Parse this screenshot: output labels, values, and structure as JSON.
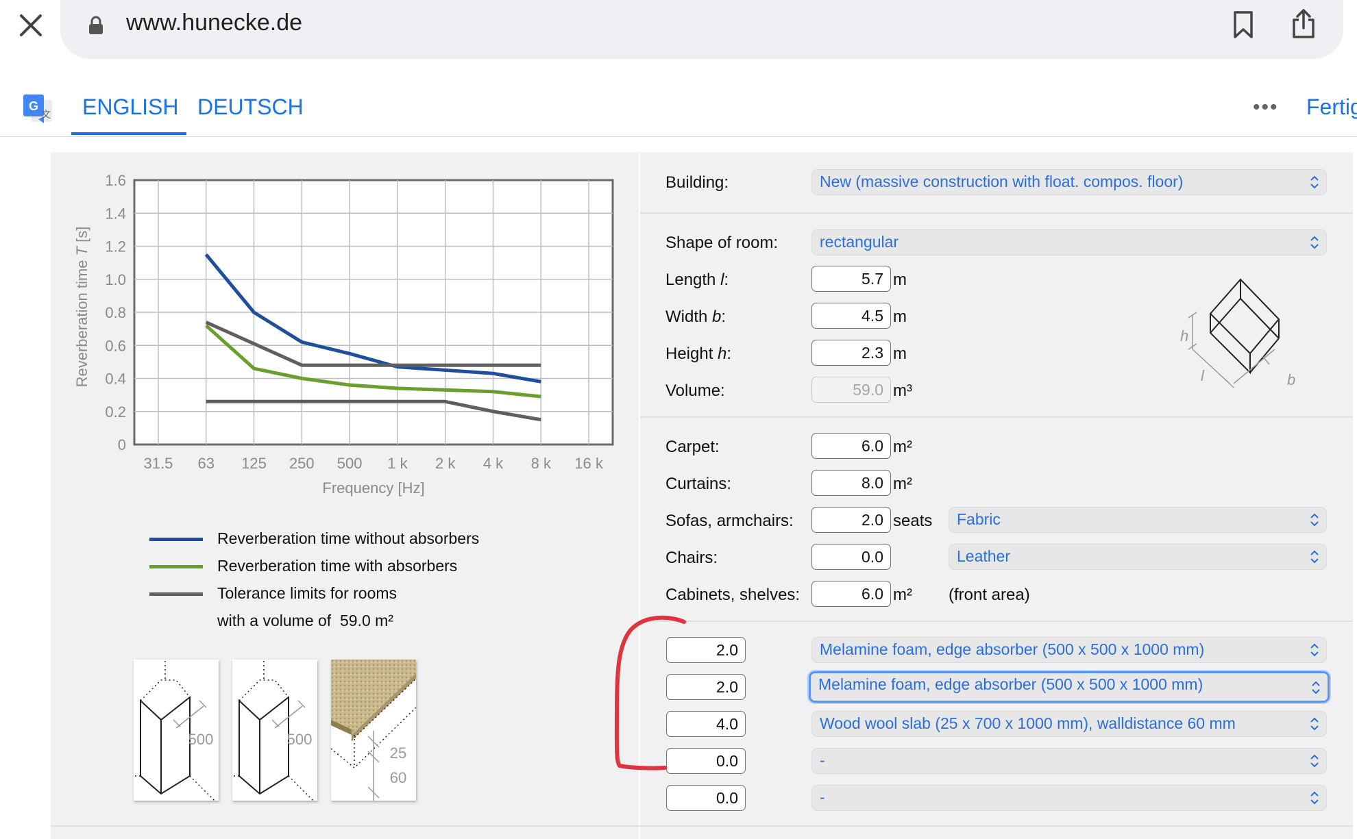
{
  "browser": {
    "url": "www.hunecke.de",
    "icons": [
      "close-icon",
      "lock-icon",
      "bookmark-icon",
      "share-icon"
    ]
  },
  "translate_bar": {
    "tab_english": "ENGLISH",
    "tab_deutsch": "DEUTSCH",
    "more": "•••",
    "done": "Fertig",
    "accent": "#1a73e8"
  },
  "room": {
    "building_label": "Building:",
    "building_value": "New (massive construction with float. compos. floor)",
    "shape_label": "Shape of room:",
    "shape_value": "rectangular",
    "length_label": "Length ",
    "length_var": "l",
    "length_value": "5.7",
    "width_label": "Width ",
    "width_var": "b",
    "width_value": "4.5",
    "height_label": "Height ",
    "height_var": "h",
    "height_value": "2.3",
    "volume_label": "Volume:",
    "volume_value": "59.0",
    "unit_m": "m",
    "unit_m3": "m³",
    "diagram_h": "h",
    "diagram_l": "l",
    "diagram_b": "b"
  },
  "furniture": {
    "carpet_label": "Carpet:",
    "carpet_value": "6.0",
    "curtains_label": "Curtains:",
    "curtains_value": "8.0",
    "sofas_label": "Sofas, armchairs:",
    "sofas_value": "2.0",
    "sofas_unit": "seats",
    "sofas_material": "Fabric",
    "chairs_label": "Chairs:",
    "chairs_value": "0.0",
    "chairs_material": "Leather",
    "cabinets_label": "Cabinets, shelves:",
    "cabinets_value": "6.0",
    "cabinets_note": "(front area)",
    "unit_m2": "m²"
  },
  "absorbers": [
    {
      "qty": "2.0",
      "type": "Melamine foam, edge absorber (500 x 500 x 1000 mm)"
    },
    {
      "qty": "2.0",
      "type": "Melamine foam, edge absorber (500 x 500 x 1000 mm)"
    },
    {
      "qty": "4.0",
      "type": "Wood wool slab (25 x 700 x 1000 mm), walldistance 60 mm"
    },
    {
      "qty": "0.0",
      "type": "-"
    },
    {
      "qty": "0.0",
      "type": "-"
    }
  ],
  "legend": {
    "without": "Reverberation time without absorbers",
    "with": "Reverberation time with absorbers",
    "tolerance": "Tolerance limits for rooms",
    "volume_prefix": "with a volume of",
    "volume_value": "59.0 m²"
  },
  "thumbnails": {
    "dim_500": "500",
    "dim_25": "25",
    "dim_60": "60"
  },
  "chart_data": {
    "type": "line",
    "ylabel_prefix": "Reverberation time ",
    "ylabel_var": "T",
    "ylabel_suffix": " [s]",
    "xlabel": "Frequency [Hz]",
    "categories": [
      "31.5",
      "63",
      "125",
      "250",
      "500",
      "1 k",
      "2 k",
      "4 k",
      "8 k",
      "16 k"
    ],
    "y_ticks": [
      "0",
      "0.2",
      "0.4",
      "0.6",
      "0.8",
      "1.0",
      "1.2",
      "1.4",
      "1.6"
    ],
    "ylim": [
      0,
      1.6
    ],
    "grid": true,
    "series": [
      {
        "name": "Reverberation time without absorbers",
        "color": "#1f4e9c",
        "x": [
          "63",
          "125",
          "250",
          "500",
          "1 k",
          "2 k",
          "4 k",
          "8 k"
        ],
        "values": [
          1.15,
          0.8,
          0.62,
          0.55,
          0.47,
          0.45,
          0.43,
          0.38
        ]
      },
      {
        "name": "Reverberation time with absorbers",
        "color": "#6a9f2e",
        "x": [
          "63",
          "125",
          "250",
          "500",
          "1 k",
          "2 k",
          "4 k",
          "8 k"
        ],
        "values": [
          0.72,
          0.46,
          0.4,
          0.36,
          0.34,
          0.33,
          0.32,
          0.29
        ]
      },
      {
        "name": "Tolerance limits for rooms",
        "color": "#5f5f5f",
        "x": [
          "63",
          "125",
          "250",
          "500",
          "1 k",
          "2 k",
          "4 k",
          "8 k"
        ],
        "values": [
          0.74,
          0.61,
          0.48,
          0.48,
          0.48,
          0.48,
          0.48,
          0.48
        ]
      },
      {
        "name": "Tolerance limits for rooms",
        "color": "#5f5f5f",
        "x": [
          "63",
          "125",
          "250",
          "500",
          "1 k",
          "2 k",
          "4 k",
          "8 k"
        ],
        "values": [
          0.26,
          0.26,
          0.26,
          0.26,
          0.26,
          0.26,
          0.2,
          0.15
        ]
      }
    ]
  }
}
